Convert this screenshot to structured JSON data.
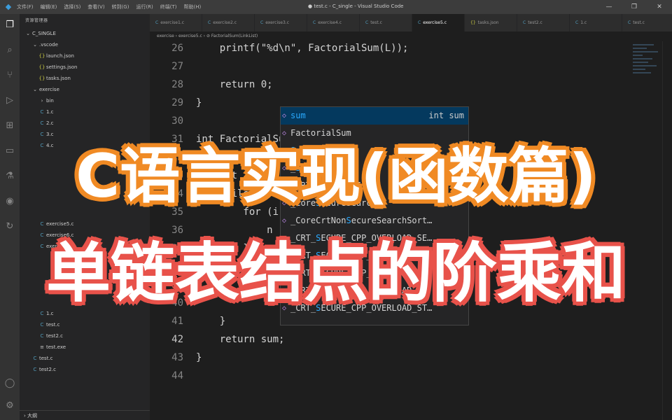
{
  "titlebar": {
    "menu": [
      "文件(F)",
      "编辑(E)",
      "选择(S)",
      "查看(V)",
      "转到(G)",
      "运行(R)",
      "终端(T)",
      "帮助(H)"
    ],
    "window_title": "● test.c - C_single - Visual Studio Code",
    "controls": [
      "—",
      "❐",
      "✕"
    ]
  },
  "activity_icons": [
    "explorer-icon",
    "search-icon",
    "source-control-icon",
    "run-debug-icon",
    "extensions-icon",
    "remote-icon",
    "flask-icon",
    "github-icon",
    "share-icon",
    "account-icon",
    "settings-icon"
  ],
  "sidebar": {
    "header": "资源管理器",
    "items": [
      {
        "label": "C_SINGLE",
        "icon": "⌄",
        "indent": 0
      },
      {
        "label": ".vscode",
        "icon": "⌄",
        "indent": 1
      },
      {
        "label": "launch.json",
        "icon": "{}",
        "indent": 2
      },
      {
        "label": "settings.json",
        "icon": "{}",
        "indent": 2
      },
      {
        "label": "tasks.json",
        "icon": "{}",
        "indent": 2
      },
      {
        "label": "exercise",
        "icon": "⌄",
        "indent": 1
      },
      {
        "label": "bin",
        "icon": "›",
        "indent": 2
      },
      {
        "label": "1.c",
        "icon": "C",
        "indent": 2
      },
      {
        "label": "2.c",
        "icon": "C",
        "indent": 2
      },
      {
        "label": "3.c",
        "icon": "C",
        "indent": 2
      },
      {
        "label": "4.c",
        "icon": "C",
        "indent": 2
      },
      {
        "label": "",
        "icon": "",
        "indent": 2
      },
      {
        "label": "",
        "icon": "",
        "indent": 2
      },
      {
        "label": "",
        "icon": "",
        "indent": 2
      },
      {
        "label": "",
        "icon": "",
        "indent": 2
      },
      {
        "label": "",
        "icon": "",
        "indent": 2
      },
      {
        "label": "",
        "icon": "",
        "indent": 2
      },
      {
        "label": "exercise5.c",
        "icon": "C",
        "indent": 2
      },
      {
        "label": "exercise6.c",
        "icon": "C",
        "indent": 2
      },
      {
        "label": "exercise7.c",
        "icon": "C",
        "indent": 2
      },
      {
        "label": "",
        "icon": "",
        "indent": 2
      },
      {
        "label": "",
        "icon": "",
        "indent": 2
      },
      {
        "label": "",
        "icon": "",
        "indent": 2
      },
      {
        "label": "",
        "icon": "",
        "indent": 2
      },
      {
        "label": "",
        "icon": "",
        "indent": 2
      },
      {
        "label": "1.c",
        "icon": "C",
        "indent": 2
      },
      {
        "label": "test.c",
        "icon": "C",
        "indent": 2
      },
      {
        "label": "test2.c",
        "icon": "C",
        "indent": 2
      },
      {
        "label": "test.exe",
        "icon": "≡",
        "indent": 2
      },
      {
        "label": "test.c",
        "icon": "C",
        "indent": 1
      },
      {
        "label": "test2.c",
        "icon": "C",
        "indent": 1
      }
    ],
    "status": "› 大纲"
  },
  "tabs": [
    {
      "label": "exercise1.c",
      "icon": "C"
    },
    {
      "label": "exercise2.c",
      "icon": "C"
    },
    {
      "label": "exercise3.c",
      "icon": "C"
    },
    {
      "label": "exercise4.c",
      "icon": "C"
    },
    {
      "label": "test.c",
      "icon": "C"
    },
    {
      "label": "exercise5.c",
      "icon": "C",
      "active": true
    },
    {
      "label": "tasks.json",
      "icon": "{}"
    },
    {
      "label": "test2.c",
      "icon": "C"
    },
    {
      "label": "1.c",
      "icon": "C"
    },
    {
      "label": "test.c",
      "icon": "C"
    }
  ],
  "tab_actions": [
    "▷",
    "⊟",
    "⋯"
  ],
  "breadcrumb": "exercise › exercise5.c › ⊘ FactorialSum(LinkList)",
  "code_lines": [
    {
      "n": "26",
      "code": "    printf(\"%d\\n\", FactorialSum(L));"
    },
    {
      "n": "27",
      "code": ""
    },
    {
      "n": "28",
      "code": "    return 0;"
    },
    {
      "n": "29",
      "code": "}"
    },
    {
      "n": "30",
      "code": ""
    },
    {
      "n": "31",
      "code": "int FactorialSum(LinkList L) {"
    },
    {
      "n": "32",
      "code": "    int sum = 1;"
    },
    {
      "n": "33",
      "code": "    int i = 1;"
    },
    {
      "n": "34",
      "code": "    while (L) {"
    },
    {
      "n": "35",
      "code": "        for (i = 1; ...) {"
    },
    {
      "n": "36",
      "code": "            n"
    },
    {
      "n": "37",
      "code": "        }"
    },
    {
      "n": "38",
      "code": ""
    },
    {
      "n": "39",
      "code": ""
    },
    {
      "n": "40",
      "code": ""
    },
    {
      "n": "41",
      "code": "    }"
    },
    {
      "n": "42",
      "code": "    return sum;",
      "current": true
    },
    {
      "n": "43",
      "code": "}"
    },
    {
      "n": "44",
      "code": ""
    }
  ],
  "suggest": {
    "detail": "int sum",
    "items": [
      {
        "pre": "",
        "hl": "sum",
        "post": "",
        "icon": "◇",
        "selected": true
      },
      {
        "pre": "FactorialSum",
        "hl": "",
        "post": "",
        "icon": "◇"
      },
      {
        "pre": "",
        "hl": "Su",
        "post": "cceed_1",
        "icon": "◇"
      },
      {
        "pre": "_",
        "hl": "S",
        "post": "TD_Source",
        "icon": "◇"
      },
      {
        "pre": "_CRT_",
        "hl": "S",
        "post": "ECURE_LI",
        "icon": "◇"
      },
      {
        "pre": "_Core",
        "hl": "S",
        "post": "ecureSearch",
        "icon": "◇"
      },
      {
        "pre": "_CoreCrtNon",
        "hl": "S",
        "post": "ecureSearchSort…",
        "icon": "◇"
      },
      {
        "pre": "_CRT_",
        "hl": "S",
        "post": "ECURE_CPP_OVERLOAD_SE…",
        "icon": "◇"
      },
      {
        "pre": "_CRT_",
        "hl": "S",
        "post": "ECURE_CPP_OVERLOAD_S…",
        "icon": "◇"
      },
      {
        "pre": "_CRT_",
        "hl": "S",
        "post": "ECURE_CPP_OVERLOAD_S…",
        "icon": "◇"
      },
      {
        "pre": "_CRT_",
        "hl": "S",
        "post": "ECURE_CPP_OVERLOAD_S…",
        "icon": "◇"
      },
      {
        "pre": "_CRT_",
        "hl": "S",
        "post": "ECURE_CPP_OVERLOAD_ST…",
        "icon": "◇"
      }
    ]
  },
  "overlay": {
    "line1": "C语言实现(函数篇)",
    "line2": "单链表结点的阶乘和",
    "color1": "#f08a24",
    "color2": "#e8524a"
  }
}
